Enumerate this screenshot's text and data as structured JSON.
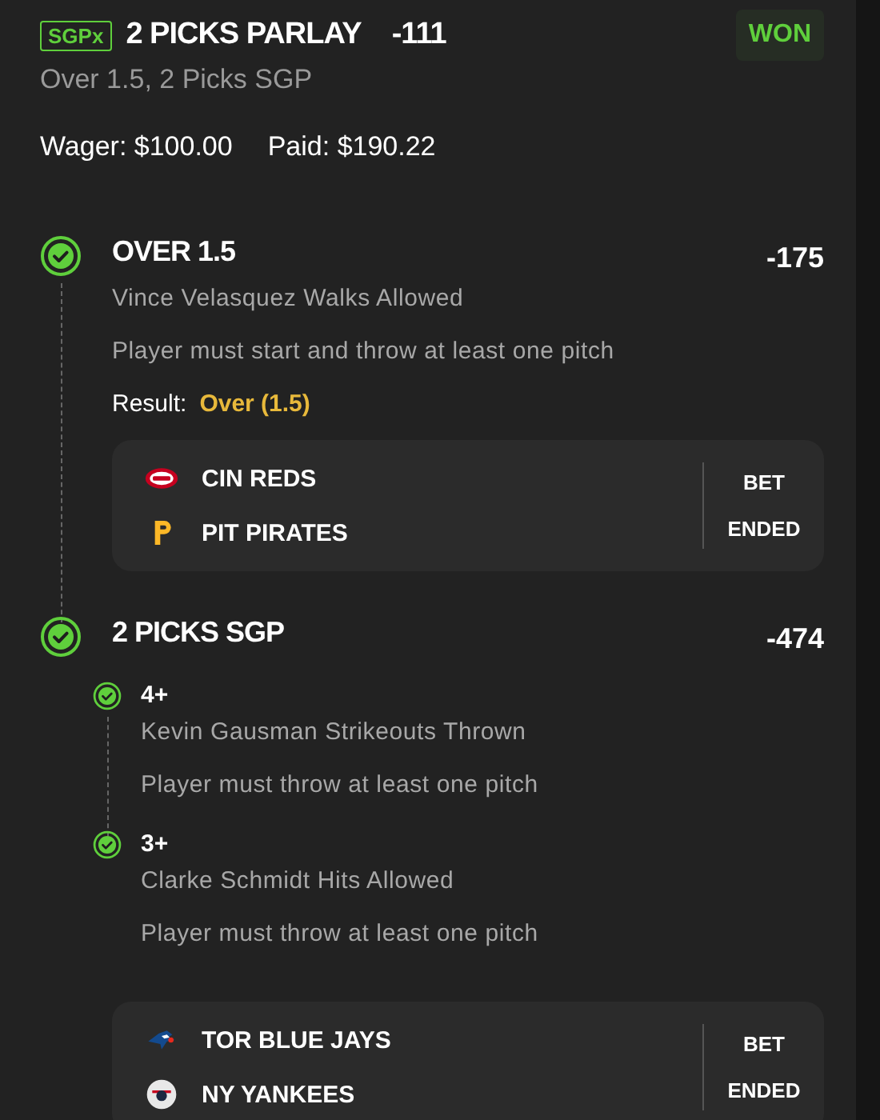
{
  "header": {
    "badge": "SGPx",
    "title": "2 PICKS PARLAY",
    "odds": "-111",
    "status": "WON",
    "subtitle": "Over 1.5, 2 Picks SGP",
    "wager": "Wager: $100.00",
    "paid": "Paid: $190.22"
  },
  "legs": [
    {
      "kind": "single",
      "won": true,
      "title": "OVER 1.5",
      "odds": "-175",
      "description": "Vince Velasquez Walks Allowed",
      "rule": "Player must start and throw at least one pitch",
      "result_label": "Result:",
      "result_value": "Over (1.5)",
      "game": {
        "teams": [
          {
            "name": "CIN REDS",
            "kind": "reds"
          },
          {
            "name": "PIT PIRATES",
            "kind": "pirates"
          }
        ],
        "status": [
          "BET",
          "ENDED"
        ]
      }
    },
    {
      "kind": "sgp",
      "won": true,
      "title": "2 PICKS SGP",
      "odds": "-474",
      "picks": [
        {
          "won": true,
          "title": "4+",
          "description": "Kevin Gausman Strikeouts Thrown",
          "rule": "Player must throw at least one pitch"
        },
        {
          "won": true,
          "title": "3+",
          "description": "Clarke Schmidt Hits Allowed",
          "rule": "Player must throw at least one pitch"
        }
      ],
      "game": {
        "teams": [
          {
            "name": "TOR BLUE JAYS",
            "kind": "bluejays"
          },
          {
            "name": "NY YANKEES",
            "kind": "yankees"
          }
        ],
        "status": [
          "BET",
          "ENDED"
        ]
      }
    }
  ]
}
